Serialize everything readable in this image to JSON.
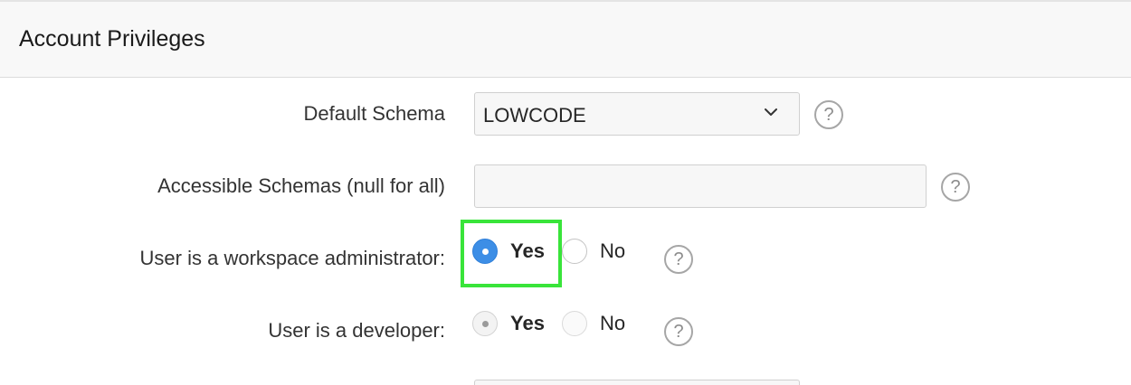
{
  "region": {
    "title": "Account Privileges"
  },
  "fields": {
    "default_schema": {
      "label": "Default Schema",
      "value": "LOWCODE",
      "help": "?"
    },
    "accessible_schemas": {
      "label": "Accessible Schemas (null for all)",
      "value": "",
      "help": "?"
    },
    "workspace_admin": {
      "label": "User is a workspace administrator:",
      "options": [
        "Yes",
        "No"
      ],
      "selected": "Yes",
      "help": "?"
    },
    "developer": {
      "label": "User is a developer:",
      "options": [
        "Yes",
        "No"
      ],
      "selected": "Yes",
      "disabled": true,
      "help": "?"
    }
  },
  "colors": {
    "accent_blue": "#3d8ee6",
    "highlight_green": "#39e43a"
  },
  "icons": {
    "select_chevron": "chevron-down-icon",
    "help": "help-icon"
  }
}
